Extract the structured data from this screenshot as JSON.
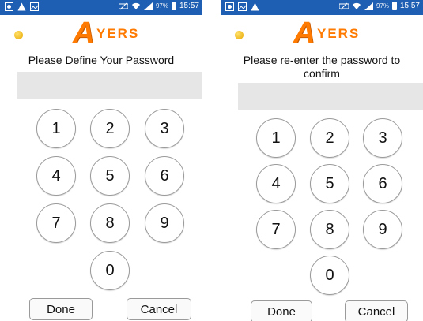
{
  "status_bar": {
    "battery_percent": "97%",
    "time": "15:57"
  },
  "app": {
    "logo_letter": "A",
    "logo_word": "YERS"
  },
  "left_screen": {
    "prompt": "Please Define Your Password",
    "keys": [
      "1",
      "2",
      "3",
      "4",
      "5",
      "6",
      "7",
      "8",
      "9",
      "0"
    ],
    "done_label": "Done",
    "cancel_label": "Cancel"
  },
  "right_screen": {
    "prompt": "Please re-enter the password to confirm",
    "keys": [
      "1",
      "2",
      "3",
      "4",
      "5",
      "6",
      "7",
      "8",
      "9",
      "0"
    ],
    "done_label": "Done",
    "cancel_label": "Cancel"
  },
  "colors": {
    "status_bar": "#1f5fb3",
    "brand": "#ff7a00",
    "input_bg": "#e6e6e6"
  }
}
